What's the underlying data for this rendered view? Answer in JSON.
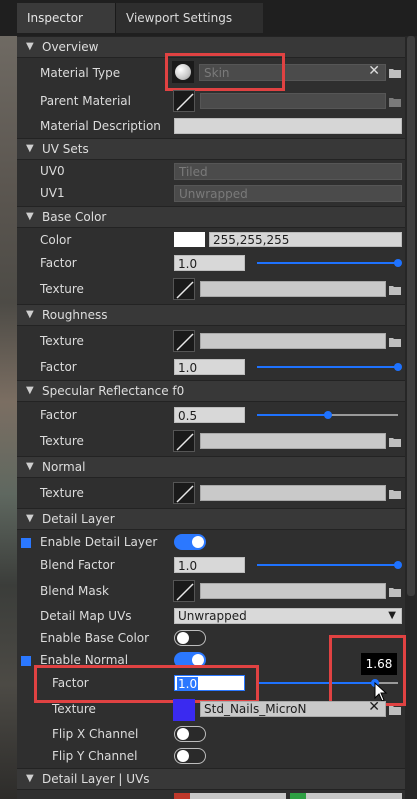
{
  "tabs": [
    {
      "label": "Inspector",
      "active": true
    },
    {
      "label": "Viewport Settings",
      "active": false
    }
  ],
  "sections": {
    "overview": "Overview",
    "uv_sets": "UV Sets",
    "base_color": "Base Color",
    "roughness": "Roughness",
    "specular": "Specular Reflectance f0",
    "normal": "Normal",
    "detail_layer": "Detail Layer",
    "detail_layer_uvs": "Detail Layer | UVs"
  },
  "overview": {
    "material_type_label": "Material Type",
    "material_type_value": "Skin",
    "parent_material_label": "Parent Material",
    "material_description_label": "Material Description"
  },
  "uv_sets": {
    "uv0_label": "UV0",
    "uv0_value": "Tiled",
    "uv1_label": "UV1",
    "uv1_value": "Unwrapped"
  },
  "base_color": {
    "color_label": "Color",
    "color_value": "255,255,255",
    "swatch_color": "#ffffff",
    "factor_label": "Factor",
    "factor_value": "1.0",
    "factor_fraction": 1.0,
    "texture_label": "Texture"
  },
  "roughness": {
    "texture_label": "Texture",
    "factor_label": "Factor",
    "factor_value": "1.0",
    "factor_fraction": 1.0
  },
  "specular": {
    "factor_label": "Factor",
    "factor_value": "0.5",
    "factor_fraction": 0.5,
    "texture_label": "Texture"
  },
  "normal": {
    "texture_label": "Texture"
  },
  "detail_layer": {
    "enable_detail_layer_label": "Enable Detail Layer",
    "enable_detail_layer_on": true,
    "blend_factor_label": "Blend Factor",
    "blend_factor_value": "1.0",
    "blend_factor_fraction": 1.0,
    "blend_mask_label": "Blend Mask",
    "detail_map_uvs_label": "Detail Map UVs",
    "detail_map_uvs_value": "Unwrapped",
    "enable_base_color_label": "Enable Base Color",
    "enable_base_color_on": false,
    "enable_normal_label": "Enable Normal",
    "enable_normal_on": true,
    "factor_label": "Factor",
    "factor_value": "1.0",
    "factor_fraction": 0.84,
    "factor_tooltip": "1.68",
    "texture_label": "Texture",
    "texture_value": "Std_Nails_MicroN",
    "texture_swatch_color": "#3a2af0",
    "flip_x_label": "Flip X Channel",
    "flip_x_on": false,
    "flip_y_label": "Flip Y Channel",
    "flip_y_on": false
  },
  "colors": {
    "accent": "#1e72ff",
    "highlight": "#e04242",
    "panel": "#2f2f2f",
    "section_header": "#383838"
  },
  "icons": [
    "chevron-down-icon",
    "folder-icon",
    "close-icon",
    "checkbox-icon",
    "mouse-cursor-icon",
    "sphere-icon"
  ]
}
